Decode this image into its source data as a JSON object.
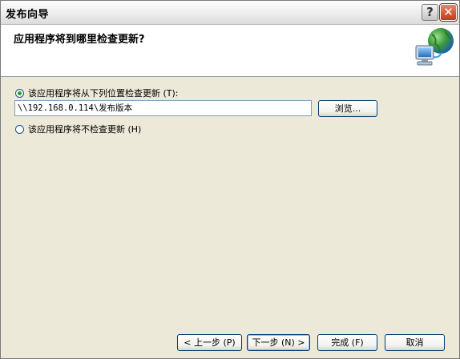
{
  "window": {
    "title": "发布向导",
    "help_symbol": "?",
    "close_symbol": "✕"
  },
  "header": {
    "title": "应用程序将到哪里检查更新?",
    "icon": "globe-network-icon"
  },
  "options": {
    "check_location": {
      "label": "该应用程序将从下列位置检查更新 (T):",
      "checked": true
    },
    "location_value": "\\\\192.168.0.114\\发布版本",
    "browse_label": "浏览...",
    "no_check": {
      "label": "该应用程序将不检查更新 (H)",
      "checked": false
    }
  },
  "footer": {
    "back_label": "< 上一步 (P)",
    "next_label": "下一步 (N) >",
    "finish_label": "完成 (F)",
    "cancel_label": "取消"
  },
  "colors": {
    "header_bg": "#ffffff",
    "body_bg": "#ece9d8",
    "close_red": "#c2391b",
    "radio_dot": "#21a121"
  }
}
